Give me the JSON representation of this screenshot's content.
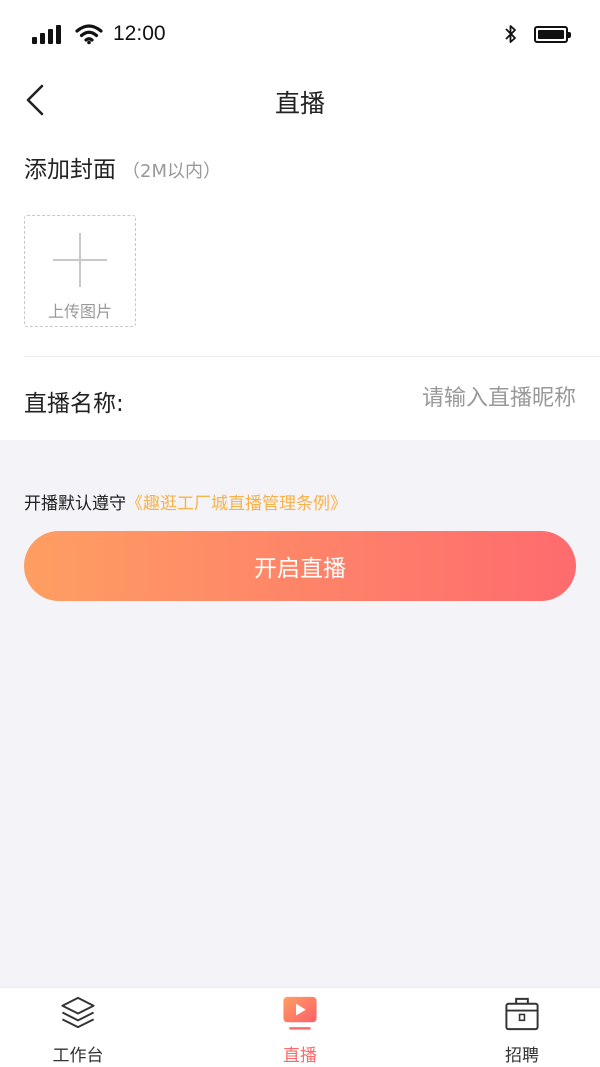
{
  "status_bar": {
    "time": "12:00"
  },
  "nav": {
    "title": "直播",
    "back_icon": "chevron-left-icon"
  },
  "form": {
    "cover_title": "添加封面",
    "cover_hint": "（2M以内）",
    "upload_label": "上传图片",
    "name_label": "直播名称:",
    "name_value": "",
    "name_placeholder": "请输入直播昵称"
  },
  "agreement": {
    "prefix": "开播默认遵守",
    "link": "《趣逛工厂城直播管理条例》"
  },
  "start_button": {
    "label": "开启直播"
  },
  "colors": {
    "accent_link": "#f7b24a",
    "button_gradient_start": "#fe9e62",
    "button_gradient_end": "#fe6b6f",
    "active_tab": "#fd6a6a"
  },
  "tabbar": {
    "items": [
      {
        "label": "工作台",
        "icon": "layers-icon",
        "active": false
      },
      {
        "label": "直播",
        "icon": "play-video-icon",
        "active": true
      },
      {
        "label": "招聘",
        "icon": "briefcase-icon",
        "active": false
      }
    ]
  }
}
